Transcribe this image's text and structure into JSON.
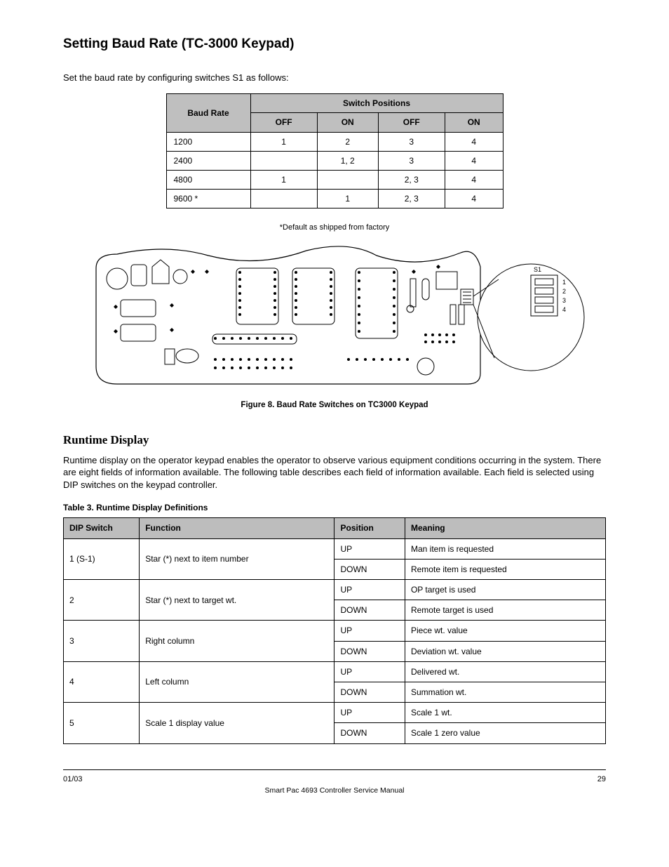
{
  "title": "Setting Baud Rate (TC-3000 Keypad)",
  "intro": "Set the baud rate by configuring switches S1 as follows:",
  "table1": {
    "rowhead": "Baud Rate",
    "colgroup": "Switch Positions",
    "cols": [
      "OFF",
      "ON",
      "OFF",
      "ON"
    ],
    "rows": [
      {
        "rate": "1200",
        "vals": [
          "1",
          "2",
          "3",
          "4"
        ]
      },
      {
        "rate": "2400",
        "vals": [
          "",
          "1, 2",
          "3",
          "4"
        ]
      },
      {
        "rate": "4800",
        "vals": [
          "1",
          "",
          "2, 3",
          "4"
        ]
      },
      {
        "rate": "9600 *",
        "vals": [
          "",
          "1",
          "2, 3",
          "4"
        ]
      }
    ],
    "footnote": "*Default as shipped from factory"
  },
  "caption": "Figure 8. Baud Rate Switches on TC3000 Keypad",
  "dip": {
    "sw": "S1",
    "labels": [
      "1",
      "2",
      "3",
      "4"
    ]
  },
  "runtime": {
    "title": "Runtime Display",
    "para": "Runtime display on the operator keypad enables the operator to observe various equipment conditions occurring in the system. There are eight fields of information available. The following table describes each field of information available. Each field is selected using DIP switches on the keypad controller.",
    "table_caption": "Table 3. Runtime Display Definitions",
    "headers": [
      "DIP Switch",
      "Function",
      "Position",
      "Meaning"
    ],
    "rows": [
      {
        "sw": "1 (S-1)",
        "fn": "Star (*) next to item number",
        "pairs": [
          [
            "UP",
            "Man item is requested"
          ],
          [
            "DOWN",
            "Remote item is requested"
          ]
        ]
      },
      {
        "sw": "2",
        "fn": "Star (*) next to target wt.",
        "pairs": [
          [
            "UP",
            "OP target is used"
          ],
          [
            "DOWN",
            "Remote target is used"
          ]
        ]
      },
      {
        "sw": "3",
        "fn": "Right column",
        "pairs": [
          [
            "UP",
            "Piece wt. value"
          ],
          [
            "DOWN",
            "Deviation wt. value"
          ]
        ]
      },
      {
        "sw": "4",
        "fn": "Left column",
        "pairs": [
          [
            "UP",
            "Delivered wt."
          ],
          [
            "DOWN",
            "Summation wt."
          ]
        ]
      },
      {
        "sw": "5",
        "fn": "Scale 1 display value",
        "pairs": [
          [
            "UP",
            "Scale 1 wt."
          ],
          [
            "DOWN",
            "Scale 1 zero value"
          ]
        ]
      }
    ]
  },
  "footer": {
    "left": "01/03",
    "right": "29",
    "doc": "Smart Pac 4693 Controller Service Manual"
  }
}
